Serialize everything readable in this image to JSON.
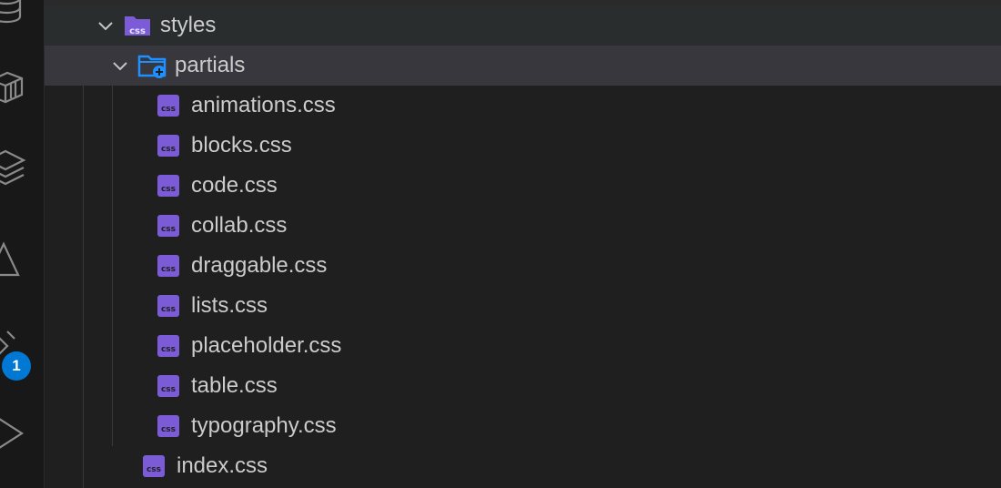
{
  "activity_bar": {
    "icons": [
      "database-icon",
      "container-icon",
      "layers-icon",
      "triangle-icon",
      "source-control-icon",
      "run-debug-icon"
    ],
    "badge_count": "1"
  },
  "explorer": {
    "folders": [
      {
        "name": "styles",
        "icon": "css-folder-icon",
        "expanded": true
      },
      {
        "name": "partials",
        "icon": "folder-open-icon",
        "expanded": true
      }
    ],
    "partials_files": [
      "animations.css",
      "blocks.css",
      "code.css",
      "collab.css",
      "draggable.css",
      "lists.css",
      "placeholder.css",
      "table.css",
      "typography.css"
    ],
    "styles_files": [
      "index.css"
    ]
  },
  "colors": {
    "background": "#1f1f1f",
    "selected_row": "#37373d",
    "css_icon": "#7b5bd6",
    "folder_blue": "#1e90ff",
    "badge": "#0078d4",
    "text": "#cccccc"
  }
}
